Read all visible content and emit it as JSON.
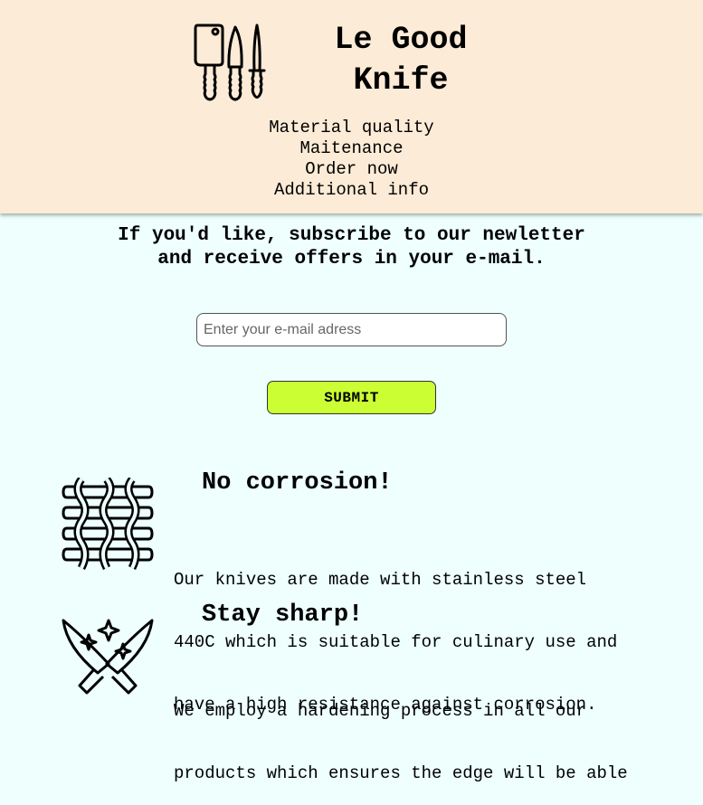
{
  "header": {
    "brand_line1": "Le Good",
    "brand_line2": "Knife",
    "logo_icon": "knives-icon",
    "nav": [
      "Material quality",
      "Maitenance",
      "Order now",
      "Additional info"
    ]
  },
  "newsletter": {
    "line1": "If you'd like, subscribe to our newletter",
    "line2": "and receive offers in your e-mail.",
    "email_placeholder": "Enter your e-mail adress",
    "submit_label": "SUBMIT"
  },
  "features": [
    {
      "icon": "woven-mesh-icon",
      "title": "No corrosion!",
      "lines": [
        "Our knives are made with stainless steel",
        "440C which is suitable for culinary use and",
        "have a high resistance against corrosion."
      ]
    },
    {
      "icon": "crossed-knives-sparkle-icon",
      "title": "Stay sharp!",
      "lines": [
        "We employ a hardening process in all our",
        "products which ensures the edge will be able"
      ]
    }
  ],
  "colors": {
    "header_bg": "#fcebd6",
    "page_bg": "#eefffe",
    "submit_bg": "#ccff33"
  }
}
